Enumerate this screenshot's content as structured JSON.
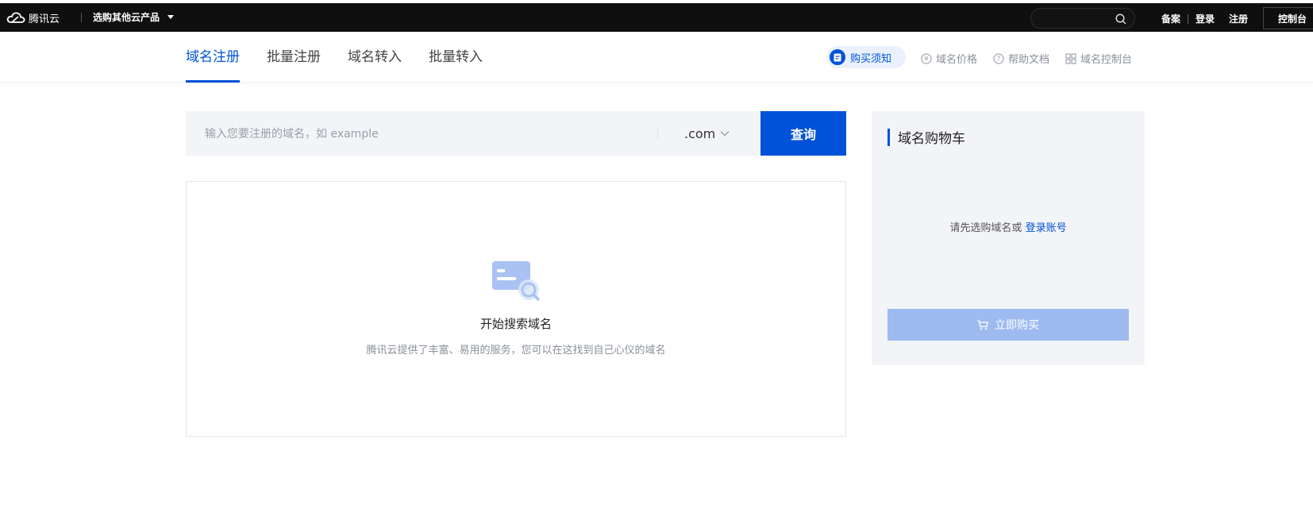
{
  "colors": {
    "accent": "#0052d9",
    "topbar": "#0f0f0f",
    "panel": "#f3f4f7",
    "disabled_button": "#9ebbf0"
  },
  "topbar": {
    "logo_text": "腾讯云",
    "products_label": "选购其他云产品",
    "search_placeholder": "",
    "links": {
      "beian": "备案",
      "login": "登录",
      "register": "注册"
    },
    "console_label": "控制台"
  },
  "subnav": {
    "tabs": [
      {
        "label": "域名注册",
        "active": true
      },
      {
        "label": "批量注册",
        "active": false
      },
      {
        "label": "域名转入",
        "active": false
      },
      {
        "label": "批量转入",
        "active": false
      }
    ],
    "notice_label": "购买须知",
    "help_links": [
      {
        "label": "域名价格",
        "icon": "yen-circle-icon"
      },
      {
        "label": "帮助文档",
        "icon": "question-circle-icon"
      },
      {
        "label": "域名控制台",
        "icon": "grid-icon"
      }
    ]
  },
  "search": {
    "placeholder": "输入您要注册的域名，如 example",
    "value": "",
    "suffix": ".com",
    "button_label": "查询"
  },
  "results": {
    "empty_icon": "domain-search-icon",
    "empty_title": "开始搜索域名",
    "empty_desc": "腾讯云提供了丰富、易用的服务，您可以在这找到自己心仪的域名"
  },
  "cart": {
    "title": "域名购物车",
    "empty_text": "请先选购域名或",
    "login_link": "登录账号",
    "buy_label": "立即购买"
  }
}
